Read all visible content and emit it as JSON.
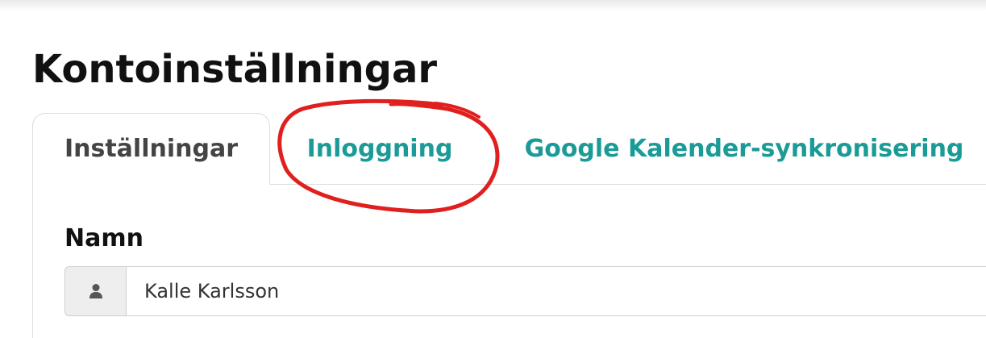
{
  "page": {
    "title": "Kontoinställningar"
  },
  "tabs": [
    {
      "label": "Inställningar",
      "active": true
    },
    {
      "label": "Inloggning",
      "active": false
    },
    {
      "label": "Google Kalender-synkronisering",
      "active": false
    }
  ],
  "form": {
    "name_label": "Namn",
    "name_icon": "user-icon",
    "name_value": "Kalle Karlsson"
  },
  "colors": {
    "tab_link": "#1b9b97",
    "annotation": "#e0201e"
  }
}
